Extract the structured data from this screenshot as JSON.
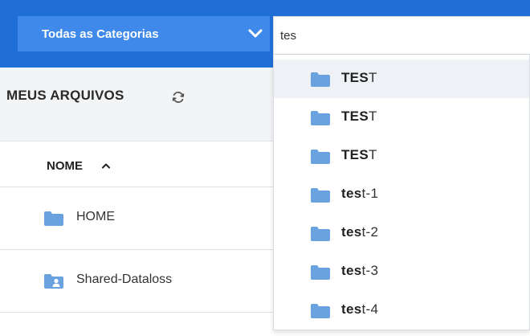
{
  "header": {
    "category_label": "Todas as Categorias",
    "search_value": "tes"
  },
  "files": {
    "title": "MEUS ARQUIVOS",
    "column_name": "NOME",
    "rows": [
      {
        "name": "HOME",
        "icon": "folder-icon"
      },
      {
        "name": "Shared-Dataloss",
        "icon": "shared-folder-icon"
      }
    ]
  },
  "dropdown": {
    "items": [
      {
        "match": "TES",
        "rest": "T",
        "icon": "folder-icon"
      },
      {
        "match": "TES",
        "rest": "T",
        "icon": "folder-icon"
      },
      {
        "match": "TES",
        "rest": "T",
        "icon": "folder-icon"
      },
      {
        "match": "tes",
        "rest": "t-1",
        "icon": "folder-icon"
      },
      {
        "match": "tes",
        "rest": "t-2",
        "icon": "folder-icon"
      },
      {
        "match": "tes",
        "rest": "t-3",
        "icon": "folder-icon"
      },
      {
        "match": "tes",
        "rest": "t-4",
        "icon": "folder-icon"
      }
    ]
  },
  "colors": {
    "topbar": "#1f6fd6",
    "category_button": "#3f89ea",
    "folder": "#6aa2e0",
    "hover_row": "#eef1f5"
  }
}
